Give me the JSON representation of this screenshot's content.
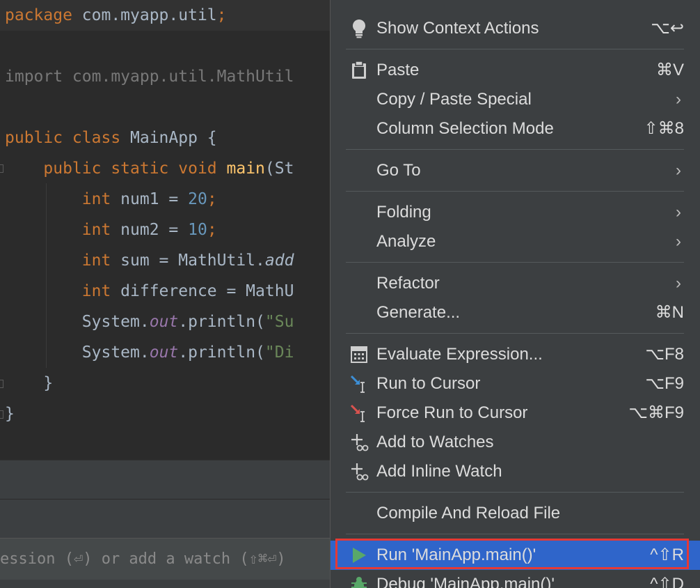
{
  "editor": {
    "lines": [
      {
        "parts": [
          {
            "t": "package ",
            "c": "kw"
          },
          {
            "t": "com.myapp.util",
            "c": ""
          },
          {
            "t": ";",
            "c": "kw"
          }
        ]
      },
      {
        "parts": []
      },
      {
        "parts": [
          {
            "t": "import com.myapp.util.MathUtil",
            "c": "dim"
          }
        ]
      },
      {
        "parts": []
      },
      {
        "parts": [
          {
            "t": "public class ",
            "c": "kw"
          },
          {
            "t": "MainApp {",
            "c": ""
          }
        ]
      },
      {
        "parts": [
          {
            "t": "    public static void ",
            "c": "kw"
          },
          {
            "t": "main",
            "c": "fn"
          },
          {
            "t": "(St",
            "c": ""
          }
        ]
      },
      {
        "parts": [
          {
            "t": "        int ",
            "c": "kw"
          },
          {
            "t": "num1 = ",
            "c": ""
          },
          {
            "t": "20",
            "c": "num"
          },
          {
            "t": ";",
            "c": "kw"
          }
        ]
      },
      {
        "parts": [
          {
            "t": "        int ",
            "c": "kw"
          },
          {
            "t": "num2 = ",
            "c": ""
          },
          {
            "t": "10",
            "c": "num"
          },
          {
            "t": ";",
            "c": "kw"
          }
        ]
      },
      {
        "parts": [
          {
            "t": "        int ",
            "c": "kw"
          },
          {
            "t": "sum = MathUtil.",
            "c": ""
          },
          {
            "t": "add",
            "c": "it"
          }
        ]
      },
      {
        "parts": [
          {
            "t": "        int ",
            "c": "kw"
          },
          {
            "t": "difference = MathU",
            "c": ""
          }
        ]
      },
      {
        "parts": [
          {
            "t": "        System.",
            "c": ""
          },
          {
            "t": "out",
            "c": "fld"
          },
          {
            "t": ".println(",
            "c": ""
          },
          {
            "t": "\"Su",
            "c": "str"
          }
        ]
      },
      {
        "parts": [
          {
            "t": "        System.",
            "c": ""
          },
          {
            "t": "out",
            "c": "fld"
          },
          {
            "t": ".println(",
            "c": ""
          },
          {
            "t": "\"Di",
            "c": "str"
          }
        ]
      },
      {
        "parts": [
          {
            "t": "    }",
            "c": ""
          }
        ]
      },
      {
        "parts": [
          {
            "t": "}",
            "c": ""
          }
        ]
      }
    ]
  },
  "watch_hint": "ession (⏎) or add a watch (⇧⌘⏎)",
  "context_menu": {
    "items": [
      {
        "label": "Show Context Actions",
        "shortcut": "⌥↩",
        "icon": "bulb"
      },
      {
        "label": "Paste",
        "shortcut": "⌘V",
        "icon": "clipboard"
      },
      {
        "label": "Copy / Paste Special",
        "arrow": true
      },
      {
        "label": "Column Selection Mode",
        "shortcut": "⇧⌘8"
      },
      {
        "label": "Go To",
        "arrow": true
      },
      {
        "label": "Folding",
        "arrow": true
      },
      {
        "label": "Analyze",
        "arrow": true
      },
      {
        "label": "Refactor",
        "arrow": true
      },
      {
        "label": "Generate...",
        "shortcut": "⌘N"
      },
      {
        "label": "Evaluate Expression...",
        "shortcut": "⌥F8",
        "icon": "calc"
      },
      {
        "label": "Run to Cursor",
        "shortcut": "⌥F9",
        "icon": "run-cursor"
      },
      {
        "label": "Force Run to Cursor",
        "shortcut": "⌥⌘F9",
        "icon": "force-run-cursor"
      },
      {
        "label": "Add to Watches",
        "icon": "watch"
      },
      {
        "label": "Add Inline Watch",
        "icon": "watch"
      },
      {
        "label": "Compile And Reload File"
      },
      {
        "label": "Run 'MainApp.main()'",
        "shortcut": "^⇧R",
        "icon": "play",
        "selected": true
      },
      {
        "label": "Debug 'MainApp.main()'",
        "shortcut": "^⇧D",
        "icon": "bug"
      }
    ]
  },
  "colors": {
    "selection": "#2f65ca",
    "highlight_border": "#e53935",
    "menu_bg": "#3c3f41",
    "editor_bg": "#2b2b2b"
  }
}
